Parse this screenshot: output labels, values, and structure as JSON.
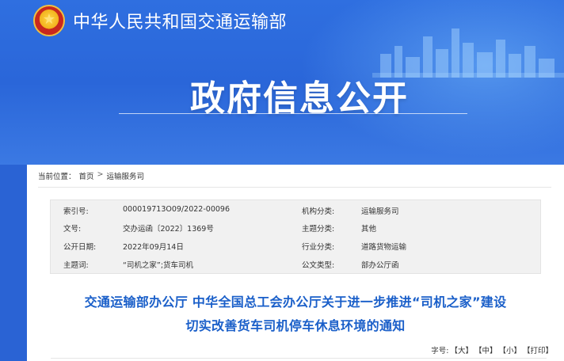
{
  "header": {
    "ministry": "中华人民共和国交通运输部",
    "section_title": "政府信息公开"
  },
  "breadcrumb": {
    "label": "当前位置：",
    "items": [
      "首页",
      "运输服务司"
    ],
    "separator": ">"
  },
  "meta": {
    "rows": [
      {
        "k1": "索引号:",
        "v1": "000019713O09/2022-00096",
        "k2": "机构分类:",
        "v2": "运输服务司"
      },
      {
        "k1": "文号:",
        "v1": "交办运函〔2022〕1369号",
        "k2": "主题分类:",
        "v2": "其他"
      },
      {
        "k1": "公开日期:",
        "v1": "2022年09月14日",
        "k2": "行业分类:",
        "v2": "道路货物运输"
      },
      {
        "k1": "主题词:",
        "v1": "“司机之家”;货车司机",
        "k2": "公文类型:",
        "v2": "部办公厅函"
      }
    ]
  },
  "article": {
    "title_line1": "交通运输部办公厅 中华全国总工会办公厅关于进一步推进“司机之家”建设",
    "title_line2": "切实改善货车司机停车休息环境的通知"
  },
  "font_size": {
    "label": "字号:",
    "large": "【大】",
    "medium": "【中】",
    "small": "【小】",
    "print": "【打印】"
  },
  "colors": {
    "banner": "#2a66d9",
    "title": "#1a5fc9"
  }
}
